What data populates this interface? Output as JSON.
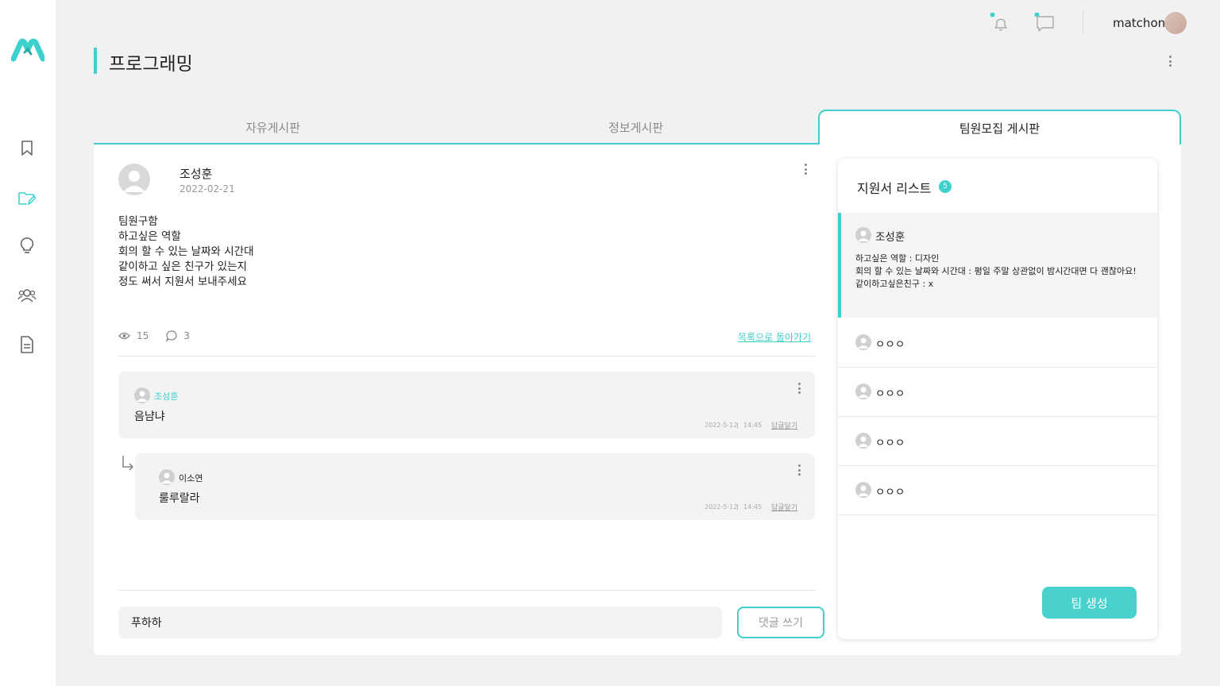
{
  "user": {
    "name": "matchon"
  },
  "page": {
    "title": "프로그래밍"
  },
  "tabs": [
    "자유게시판",
    "정보게시판",
    "팀원모집 게시판"
  ],
  "post": {
    "author": "조성훈",
    "date": "2022-02-21",
    "body": [
      "팀원구함",
      "",
      "하고싶은 역할",
      "회의 할 수 있는 날짜와 시간대",
      "같이하고 싶은 친구가 있는지",
      "",
      "정도 써서 지원서 보내주세요"
    ],
    "views": "15",
    "comments": "3",
    "back_link": "목록으로 돌아가기"
  },
  "comments": [
    {
      "author": "조성훈",
      "text": "음냠냐",
      "date": "2022-5-12",
      "time": "14:45",
      "reply_label": "답글달기"
    },
    {
      "author": "이소연",
      "text": "룰루랄라",
      "date": "2022-5-12",
      "time": "14:45",
      "reply_label": "답글달기"
    }
  ],
  "comment_box": {
    "value": "푸하하",
    "button_label": "댓글 쓰기"
  },
  "applications": {
    "title": "지원서 리스트",
    "count": "5",
    "items": [
      {
        "name": "조성훈",
        "details": [
          "하고싶은 역할 : 디자인",
          "회의 할 수 있는 날짜와 시간대 : 평일 주말 상관없이 밤시간대면 다 괜찮아요!",
          "같이하고싶은친구 : x"
        ]
      },
      {
        "name": "ㅇㅇㅇ"
      },
      {
        "name": "ㅇㅇㅇ"
      },
      {
        "name": "ㅇㅇㅇ"
      },
      {
        "name": "ㅇㅇㅇ"
      }
    ],
    "create_button": "팀 생성"
  },
  "colors": {
    "accent": "#3ed0cd",
    "background": "#f1f1f1",
    "card": "#ffffff"
  },
  "icons": [
    "logo",
    "bookmark-icon",
    "folder-edit-icon",
    "lightbulb-icon",
    "users-icon",
    "document-icon",
    "bell-icon",
    "chat-icon",
    "eye-icon",
    "comment-icon",
    "kebab-icon",
    "reply-arrow-icon",
    "avatar-icon"
  ]
}
